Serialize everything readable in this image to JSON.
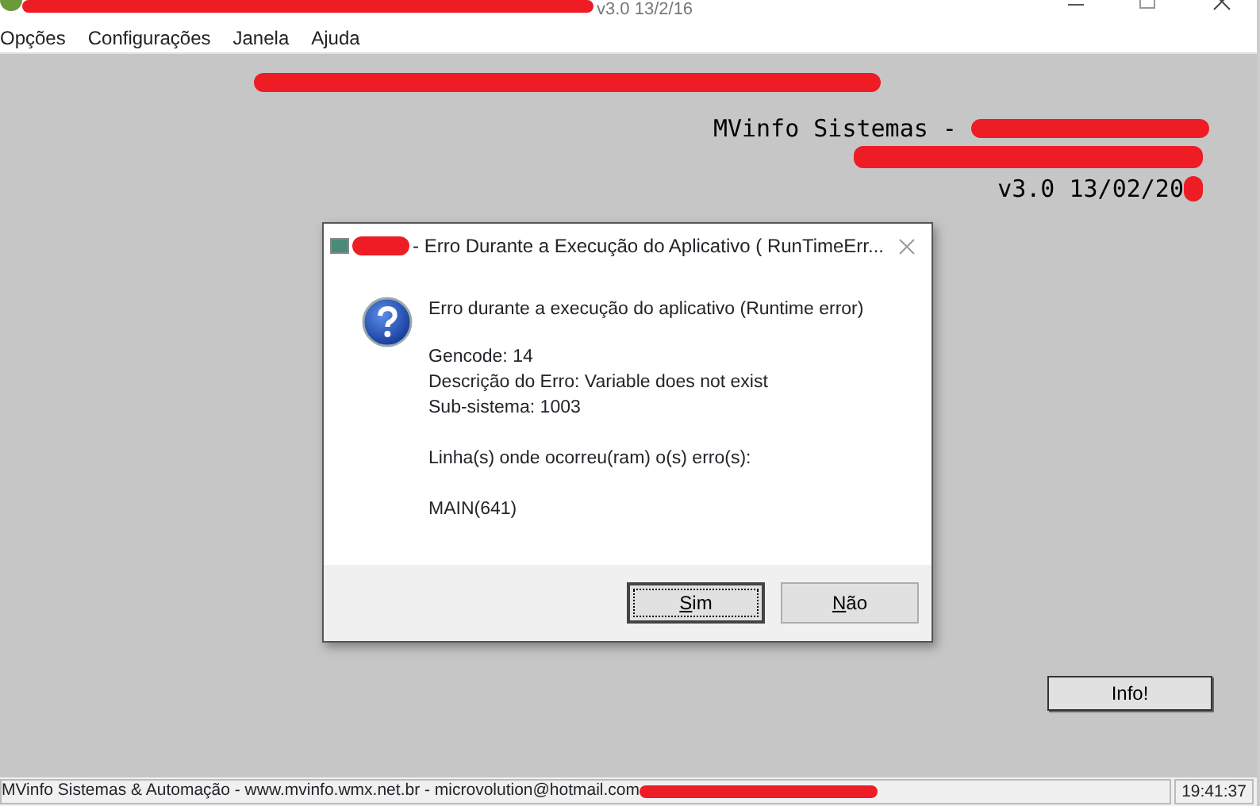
{
  "window": {
    "title": "v3.0 13/2/16"
  },
  "menu": [
    "Opções",
    "Configurações",
    "Janela",
    "Ajuda"
  ],
  "header": {
    "line_1": "MVinfo Sistemas - ",
    "line_2": "v3.0 13/02/20"
  },
  "dialog": {
    "title": "- Erro Durante a Execução do Aplicativo ( RunTimeErr...",
    "heading": "Erro durante a execução do aplicativo (Runtime error)",
    "details": [
      "Gencode: 14",
      "Descrição do Erro: Variable does not exist",
      "Sub-sistema: 1003"
    ],
    "lines_label": "Linha(s) onde ocorreu(ram) o(s) erro(s):",
    "location": "MAIN(641)",
    "buttons": [
      {
        "label": "Sim",
        "selected": true
      },
      {
        "label": "Não",
        "selected": false
      }
    ]
  },
  "info_button": "Info!",
  "status_bar": {
    "text": "MVinfo Sistemas & Automação - www.mvinfo.wmx.net.br - microvolution@hotmail.com",
    "time": "19:41:37"
  }
}
